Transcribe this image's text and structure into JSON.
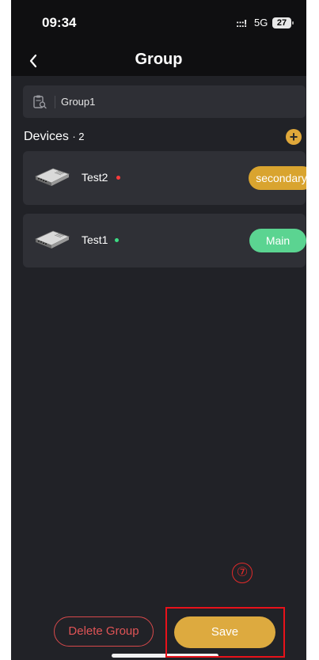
{
  "status_bar": {
    "time": "09:34",
    "signal": ":::!",
    "network": "5G",
    "battery": "27"
  },
  "header": {
    "back_label": "<",
    "title": "Group"
  },
  "group_field": {
    "value": "Group1",
    "icon": "search-document-icon"
  },
  "devices": {
    "label": "Devices",
    "count": "· 2",
    "add_label": "+"
  },
  "device_list": [
    {
      "name": "Test2",
      "status_color": "#ff3b3b",
      "role": "secondary",
      "role_color": "#d9a42f",
      "icon": "router-device-icon"
    },
    {
      "name": "Test1",
      "status_color": "#3ddc84",
      "role": "Main",
      "role_color": "#5bd491",
      "icon": "router-device-icon"
    }
  ],
  "actions": {
    "delete_label": "Delete Group",
    "save_label": "Save"
  },
  "annotation": {
    "step": "⑦",
    "color": "#e8121a"
  }
}
